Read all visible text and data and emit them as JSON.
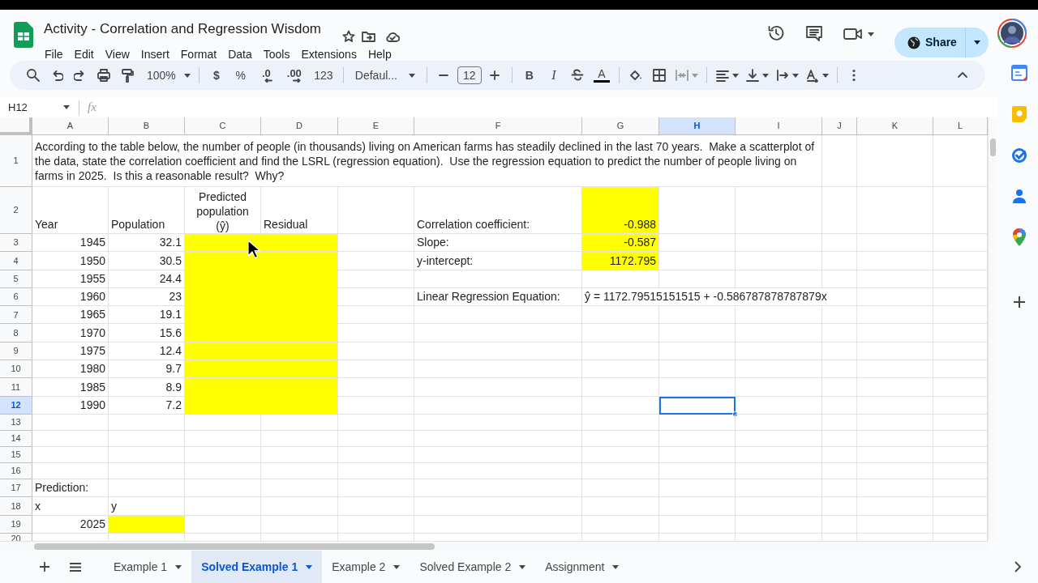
{
  "document": {
    "title": "Activity - Correlation and Regression Wisdom",
    "menus": [
      "File",
      "Edit",
      "View",
      "Insert",
      "Format",
      "Data",
      "Tools",
      "Extensions",
      "Help"
    ]
  },
  "share_button": {
    "label": "Share"
  },
  "toolbar": {
    "zoom": "100%",
    "currency": "$",
    "percent": "%",
    "decrease_decimals": ".0",
    "increase_decimals": ".00",
    "number_format": "123",
    "font": "Defaul...",
    "font_size": "12",
    "bold": "B",
    "italic": "I",
    "text_color": "A"
  },
  "formula_bar": {
    "name_box": "H12",
    "function_label": "fx"
  },
  "columns": [
    {
      "label": "A",
      "selected": false
    },
    {
      "label": "B",
      "selected": false
    },
    {
      "label": "C",
      "selected": false
    },
    {
      "label": "D",
      "selected": false
    },
    {
      "label": "E",
      "selected": false
    },
    {
      "label": "F",
      "selected": false
    },
    {
      "label": "G",
      "selected": false
    },
    {
      "label": "H",
      "selected": true
    },
    {
      "label": "I",
      "selected": false
    },
    {
      "label": "J",
      "selected": false
    },
    {
      "label": "K",
      "selected": false
    },
    {
      "label": "L",
      "selected": false
    }
  ],
  "rows": [
    {
      "number": "1",
      "selected": false,
      "cells": [
        {
          "kind": "wrapped",
          "text": "According to the table below, the number of people (in thousands) living on American farms has steadily declined in the last 70 years.  Make a scatterplot of the data, state the correlation coefficient and find the LSRL (regression equation).  Use the regression equation to predict the number of people living on farms in 2025.  Is this a reasonable result?  Why?",
          "highlighted": false,
          "selected": false
        },
        {
          "highlighted": false,
          "selected": false
        },
        {
          "highlighted": false,
          "selected": false
        },
        {
          "highlighted": false,
          "selected": false
        }
      ]
    },
    {
      "number": "2",
      "selected": false,
      "cells": [
        {
          "kind": "text",
          "text": "Year",
          "highlighted": false,
          "selected": false
        },
        {
          "kind": "text",
          "text": "Population",
          "highlighted": false,
          "selected": false
        },
        {
          "kind": "centered",
          "text": "Predicted population (ŷ)",
          "highlighted": false,
          "selected": false
        },
        {
          "kind": "text",
          "text": "Residual",
          "highlighted": false,
          "selected": false
        },
        {
          "highlighted": false,
          "selected": false
        },
        {
          "kind": "text",
          "text": "Correlation coefficient:",
          "highlighted": false,
          "selected": false
        },
        {
          "kind": "number",
          "text": "-0.988",
          "highlighted": true,
          "selected": false
        },
        {
          "highlighted": false,
          "selected": false
        },
        {
          "highlighted": false,
          "selected": false
        },
        {
          "highlighted": false,
          "selected": false
        },
        {
          "highlighted": false,
          "selected": false
        },
        {
          "highlighted": false,
          "selected": false
        }
      ]
    },
    {
      "number": "3",
      "selected": false,
      "cells": [
        {
          "kind": "number",
          "text": "1945",
          "highlighted": false,
          "selected": false
        },
        {
          "kind": "number",
          "text": "32.1",
          "highlighted": false,
          "selected": false
        },
        {
          "highlighted": true,
          "selected": false
        },
        {
          "highlighted": true,
          "selected": false
        },
        {
          "highlighted": false,
          "selected": false
        },
        {
          "kind": "text",
          "text": "Slope:",
          "highlighted": false,
          "selected": false
        },
        {
          "kind": "number",
          "text": "-0.587",
          "highlighted": true,
          "selected": false
        },
        {
          "highlighted": false,
          "selected": false
        },
        {
          "highlighted": false,
          "selected": false
        },
        {
          "highlighted": false,
          "selected": false
        },
        {
          "highlighted": false,
          "selected": false
        },
        {
          "highlighted": false,
          "selected": false
        }
      ]
    },
    {
      "number": "4",
      "selected": false,
      "cells": [
        {
          "kind": "number",
          "text": "1950",
          "highlighted": false,
          "selected": false
        },
        {
          "kind": "number",
          "text": "30.5",
          "highlighted": false,
          "selected": false
        },
        {
          "highlighted": true,
          "selected": false
        },
        {
          "highlighted": true,
          "selected": false
        },
        {
          "highlighted": false,
          "selected": false
        },
        {
          "kind": "text",
          "text": "y-intercept:",
          "highlighted": false,
          "selected": false
        },
        {
          "kind": "number",
          "text": "1172.795",
          "highlighted": true,
          "selected": false
        },
        {
          "highlighted": false,
          "selected": false
        },
        {
          "highlighted": false,
          "selected": false
        },
        {
          "highlighted": false,
          "selected": false
        },
        {
          "highlighted": false,
          "selected": false
        },
        {
          "highlighted": false,
          "selected": false
        }
      ]
    },
    {
      "number": "5",
      "selected": false,
      "cells": [
        {
          "kind": "number",
          "text": "1955",
          "highlighted": false,
          "selected": false
        },
        {
          "kind": "number",
          "text": "24.4",
          "highlighted": false,
          "selected": false
        },
        {
          "highlighted": true,
          "selected": false
        },
        {
          "highlighted": true,
          "selected": false
        },
        {
          "highlighted": false,
          "selected": false
        },
        {
          "highlighted": false,
          "selected": false
        },
        {
          "highlighted": false,
          "selected": false
        },
        {
          "highlighted": false,
          "selected": false
        },
        {
          "highlighted": false,
          "selected": false
        },
        {
          "highlighted": false,
          "selected": false
        },
        {
          "highlighted": false,
          "selected": false
        },
        {
          "highlighted": false,
          "selected": false
        }
      ]
    },
    {
      "number": "6",
      "selected": false,
      "cells": [
        {
          "kind": "number",
          "text": "1960",
          "highlighted": false,
          "selected": false
        },
        {
          "kind": "number",
          "text": "23",
          "highlighted": false,
          "selected": false
        },
        {
          "highlighted": true,
          "selected": false
        },
        {
          "highlighted": true,
          "selected": false
        },
        {
          "highlighted": false,
          "selected": false
        },
        {
          "kind": "text",
          "text": "Linear Regression Equation:",
          "highlighted": false,
          "selected": false
        },
        {
          "kind": "overflow",
          "text": "ŷ = 1172.79515151515 + -0.586787878787879x",
          "highlighted": false,
          "selected": false
        },
        {
          "highlighted": false,
          "selected": false
        },
        {
          "highlighted": false,
          "selected": false
        }
      ]
    },
    {
      "number": "7",
      "selected": false,
      "cells": [
        {
          "kind": "number",
          "text": "1965",
          "highlighted": false,
          "selected": false
        },
        {
          "kind": "number",
          "text": "19.1",
          "highlighted": false,
          "selected": false
        },
        {
          "highlighted": true,
          "selected": false
        },
        {
          "highlighted": true,
          "selected": false
        },
        {
          "highlighted": false,
          "selected": false
        },
        {
          "highlighted": false,
          "selected": false
        },
        {
          "highlighted": false,
          "selected": false
        },
        {
          "highlighted": false,
          "selected": false
        },
        {
          "highlighted": false,
          "selected": false
        },
        {
          "highlighted": false,
          "selected": false
        },
        {
          "highlighted": false,
          "selected": false
        },
        {
          "highlighted": false,
          "selected": false
        }
      ]
    },
    {
      "number": "8",
      "selected": false,
      "cells": [
        {
          "kind": "number",
          "text": "1970",
          "highlighted": false,
          "selected": false
        },
        {
          "kind": "number",
          "text": "15.6",
          "highlighted": false,
          "selected": false
        },
        {
          "highlighted": true,
          "selected": false
        },
        {
          "highlighted": true,
          "selected": false
        },
        {
          "highlighted": false,
          "selected": false
        },
        {
          "highlighted": false,
          "selected": false
        },
        {
          "highlighted": false,
          "selected": false
        },
        {
          "highlighted": false,
          "selected": false
        },
        {
          "highlighted": false,
          "selected": false
        },
        {
          "highlighted": false,
          "selected": false
        },
        {
          "highlighted": false,
          "selected": false
        },
        {
          "highlighted": false,
          "selected": false
        }
      ]
    },
    {
      "number": "9",
      "selected": false,
      "cells": [
        {
          "kind": "number",
          "text": "1975",
          "highlighted": false,
          "selected": false
        },
        {
          "kind": "number",
          "text": "12.4",
          "highlighted": false,
          "selected": false
        },
        {
          "highlighted": true,
          "selected": false
        },
        {
          "highlighted": true,
          "selected": false
        },
        {
          "highlighted": false,
          "selected": false
        },
        {
          "highlighted": false,
          "selected": false
        },
        {
          "highlighted": false,
          "selected": false
        },
        {
          "highlighted": false,
          "selected": false
        },
        {
          "highlighted": false,
          "selected": false
        },
        {
          "highlighted": false,
          "selected": false
        },
        {
          "highlighted": false,
          "selected": false
        },
        {
          "highlighted": false,
          "selected": false
        }
      ]
    },
    {
      "number": "10",
      "selected": false,
      "cells": [
        {
          "kind": "number",
          "text": "1980",
          "highlighted": false,
          "selected": false
        },
        {
          "kind": "number",
          "text": "9.7",
          "highlighted": false,
          "selected": false
        },
        {
          "highlighted": true,
          "selected": false
        },
        {
          "highlighted": true,
          "selected": false
        },
        {
          "highlighted": false,
          "selected": false
        },
        {
          "highlighted": false,
          "selected": false
        },
        {
          "highlighted": false,
          "selected": false
        },
        {
          "highlighted": false,
          "selected": false
        },
        {
          "highlighted": false,
          "selected": false
        },
        {
          "highlighted": false,
          "selected": false
        },
        {
          "highlighted": false,
          "selected": false
        },
        {
          "highlighted": false,
          "selected": false
        }
      ]
    },
    {
      "number": "11",
      "selected": false,
      "cells": [
        {
          "kind": "number",
          "text": "1985",
          "highlighted": false,
          "selected": false
        },
        {
          "kind": "number",
          "text": "8.9",
          "highlighted": false,
          "selected": false
        },
        {
          "highlighted": true,
          "selected": false
        },
        {
          "highlighted": true,
          "selected": false
        },
        {
          "highlighted": false,
          "selected": false
        },
        {
          "highlighted": false,
          "selected": false
        },
        {
          "highlighted": false,
          "selected": false
        },
        {
          "highlighted": false,
          "selected": false
        },
        {
          "highlighted": false,
          "selected": false
        },
        {
          "highlighted": false,
          "selected": false
        },
        {
          "highlighted": false,
          "selected": false
        },
        {
          "highlighted": false,
          "selected": false
        }
      ]
    },
    {
      "number": "12",
      "selected": true,
      "cells": [
        {
          "kind": "number",
          "text": "1990",
          "highlighted": false,
          "selected": false
        },
        {
          "kind": "number",
          "text": "7.2",
          "highlighted": false,
          "selected": false
        },
        {
          "highlighted": true,
          "selected": false
        },
        {
          "highlighted": true,
          "selected": false
        },
        {
          "highlighted": false,
          "selected": false
        },
        {
          "highlighted": false,
          "selected": false
        },
        {
          "highlighted": false,
          "selected": false
        },
        {
          "highlighted": false,
          "selected": true
        },
        {
          "highlighted": false,
          "selected": false
        },
        {
          "highlighted": false,
          "selected": false
        },
        {
          "highlighted": false,
          "selected": false
        },
        {
          "highlighted": false,
          "selected": false
        }
      ]
    },
    {
      "number": "13",
      "selected": false,
      "cells": [
        {
          "highlighted": false,
          "selected": false
        },
        {
          "highlighted": false,
          "selected": false
        },
        {
          "highlighted": false,
          "selected": false
        },
        {
          "highlighted": false,
          "selected": false
        },
        {
          "highlighted": false,
          "selected": false
        },
        {
          "highlighted": false,
          "selected": false
        },
        {
          "highlighted": false,
          "selected": false
        },
        {
          "highlighted": false,
          "selected": false
        },
        {
          "highlighted": false,
          "selected": false
        },
        {
          "highlighted": false,
          "selected": false
        },
        {
          "highlighted": false,
          "selected": false
        },
        {
          "highlighted": false,
          "selected": false
        }
      ]
    },
    {
      "number": "14",
      "selected": false,
      "cells": [
        {
          "highlighted": false,
          "selected": false
        },
        {
          "highlighted": false,
          "selected": false
        },
        {
          "highlighted": false,
          "selected": false
        },
        {
          "highlighted": false,
          "selected": false
        },
        {
          "highlighted": false,
          "selected": false
        },
        {
          "highlighted": false,
          "selected": false
        },
        {
          "highlighted": false,
          "selected": false
        },
        {
          "highlighted": false,
          "selected": false
        },
        {
          "highlighted": false,
          "selected": false
        },
        {
          "highlighted": false,
          "selected": false
        },
        {
          "highlighted": false,
          "selected": false
        },
        {
          "highlighted": false,
          "selected": false
        }
      ]
    },
    {
      "number": "15",
      "selected": false,
      "cells": [
        {
          "highlighted": false,
          "selected": false
        },
        {
          "highlighted": false,
          "selected": false
        },
        {
          "highlighted": false,
          "selected": false
        },
        {
          "highlighted": false,
          "selected": false
        },
        {
          "highlighted": false,
          "selected": false
        },
        {
          "highlighted": false,
          "selected": false
        },
        {
          "highlighted": false,
          "selected": false
        },
        {
          "highlighted": false,
          "selected": false
        },
        {
          "highlighted": false,
          "selected": false
        },
        {
          "highlighted": false,
          "selected": false
        },
        {
          "highlighted": false,
          "selected": false
        },
        {
          "highlighted": false,
          "selected": false
        }
      ]
    },
    {
      "number": "16",
      "selected": false,
      "cells": [
        {
          "highlighted": false,
          "selected": false
        },
        {
          "highlighted": false,
          "selected": false
        },
        {
          "highlighted": false,
          "selected": false
        },
        {
          "highlighted": false,
          "selected": false
        },
        {
          "highlighted": false,
          "selected": false
        },
        {
          "highlighted": false,
          "selected": false
        },
        {
          "highlighted": false,
          "selected": false
        },
        {
          "highlighted": false,
          "selected": false
        },
        {
          "highlighted": false,
          "selected": false
        },
        {
          "highlighted": false,
          "selected": false
        },
        {
          "highlighted": false,
          "selected": false
        },
        {
          "highlighted": false,
          "selected": false
        }
      ]
    },
    {
      "number": "17",
      "selected": false,
      "cells": [
        {
          "kind": "text",
          "text": "Prediction:",
          "highlighted": false,
          "selected": false
        },
        {
          "highlighted": false,
          "selected": false
        },
        {
          "highlighted": false,
          "selected": false
        },
        {
          "highlighted": false,
          "selected": false
        },
        {
          "highlighted": false,
          "selected": false
        },
        {
          "highlighted": false,
          "selected": false
        },
        {
          "highlighted": false,
          "selected": false
        },
        {
          "highlighted": false,
          "selected": false
        },
        {
          "highlighted": false,
          "selected": false
        },
        {
          "highlighted": false,
          "selected": false
        },
        {
          "highlighted": false,
          "selected": false
        },
        {
          "highlighted": false,
          "selected": false
        }
      ]
    },
    {
      "number": "18",
      "selected": false,
      "cells": [
        {
          "kind": "text",
          "text": "x",
          "highlighted": false,
          "selected": false
        },
        {
          "kind": "text",
          "text": "y",
          "highlighted": false,
          "selected": false
        },
        {
          "highlighted": false,
          "selected": false
        },
        {
          "highlighted": false,
          "selected": false
        },
        {
          "highlighted": false,
          "selected": false
        },
        {
          "highlighted": false,
          "selected": false
        },
        {
          "highlighted": false,
          "selected": false
        },
        {
          "highlighted": false,
          "selected": false
        },
        {
          "highlighted": false,
          "selected": false
        },
        {
          "highlighted": false,
          "selected": false
        },
        {
          "highlighted": false,
          "selected": false
        },
        {
          "highlighted": false,
          "selected": false
        }
      ]
    },
    {
      "number": "19",
      "selected": false,
      "cells": [
        {
          "kind": "number",
          "text": "2025",
          "highlighted": false,
          "selected": false
        },
        {
          "highlighted": true,
          "selected": false
        },
        {
          "highlighted": false,
          "selected": false
        },
        {
          "highlighted": false,
          "selected": false
        },
        {
          "highlighted": false,
          "selected": false
        },
        {
          "highlighted": false,
          "selected": false
        },
        {
          "highlighted": false,
          "selected": false
        },
        {
          "highlighted": false,
          "selected": false
        },
        {
          "highlighted": false,
          "selected": false
        },
        {
          "highlighted": false,
          "selected": false
        },
        {
          "highlighted": false,
          "selected": false
        },
        {
          "highlighted": false,
          "selected": false
        }
      ]
    },
    {
      "number": "20",
      "selected": false,
      "cells": [
        {
          "highlighted": false,
          "selected": false
        },
        {
          "highlighted": false,
          "selected": false
        },
        {
          "highlighted": false,
          "selected": false
        },
        {
          "highlighted": false,
          "selected": false
        },
        {
          "highlighted": false,
          "selected": false
        },
        {
          "highlighted": false,
          "selected": false
        },
        {
          "highlighted": false,
          "selected": false
        },
        {
          "highlighted": false,
          "selected": false
        },
        {
          "highlighted": false,
          "selected": false
        },
        {
          "highlighted": false,
          "selected": false
        },
        {
          "highlighted": false,
          "selected": false
        },
        {
          "highlighted": false,
          "selected": false
        }
      ]
    }
  ],
  "sheet_tabs": [
    {
      "label": "Example 1",
      "selected": false
    },
    {
      "label": "Solved Example 1",
      "selected": true
    },
    {
      "label": "Example 2",
      "selected": false
    },
    {
      "label": "Solved Example 2",
      "selected": false
    },
    {
      "label": "Assignment",
      "selected": false
    }
  ]
}
